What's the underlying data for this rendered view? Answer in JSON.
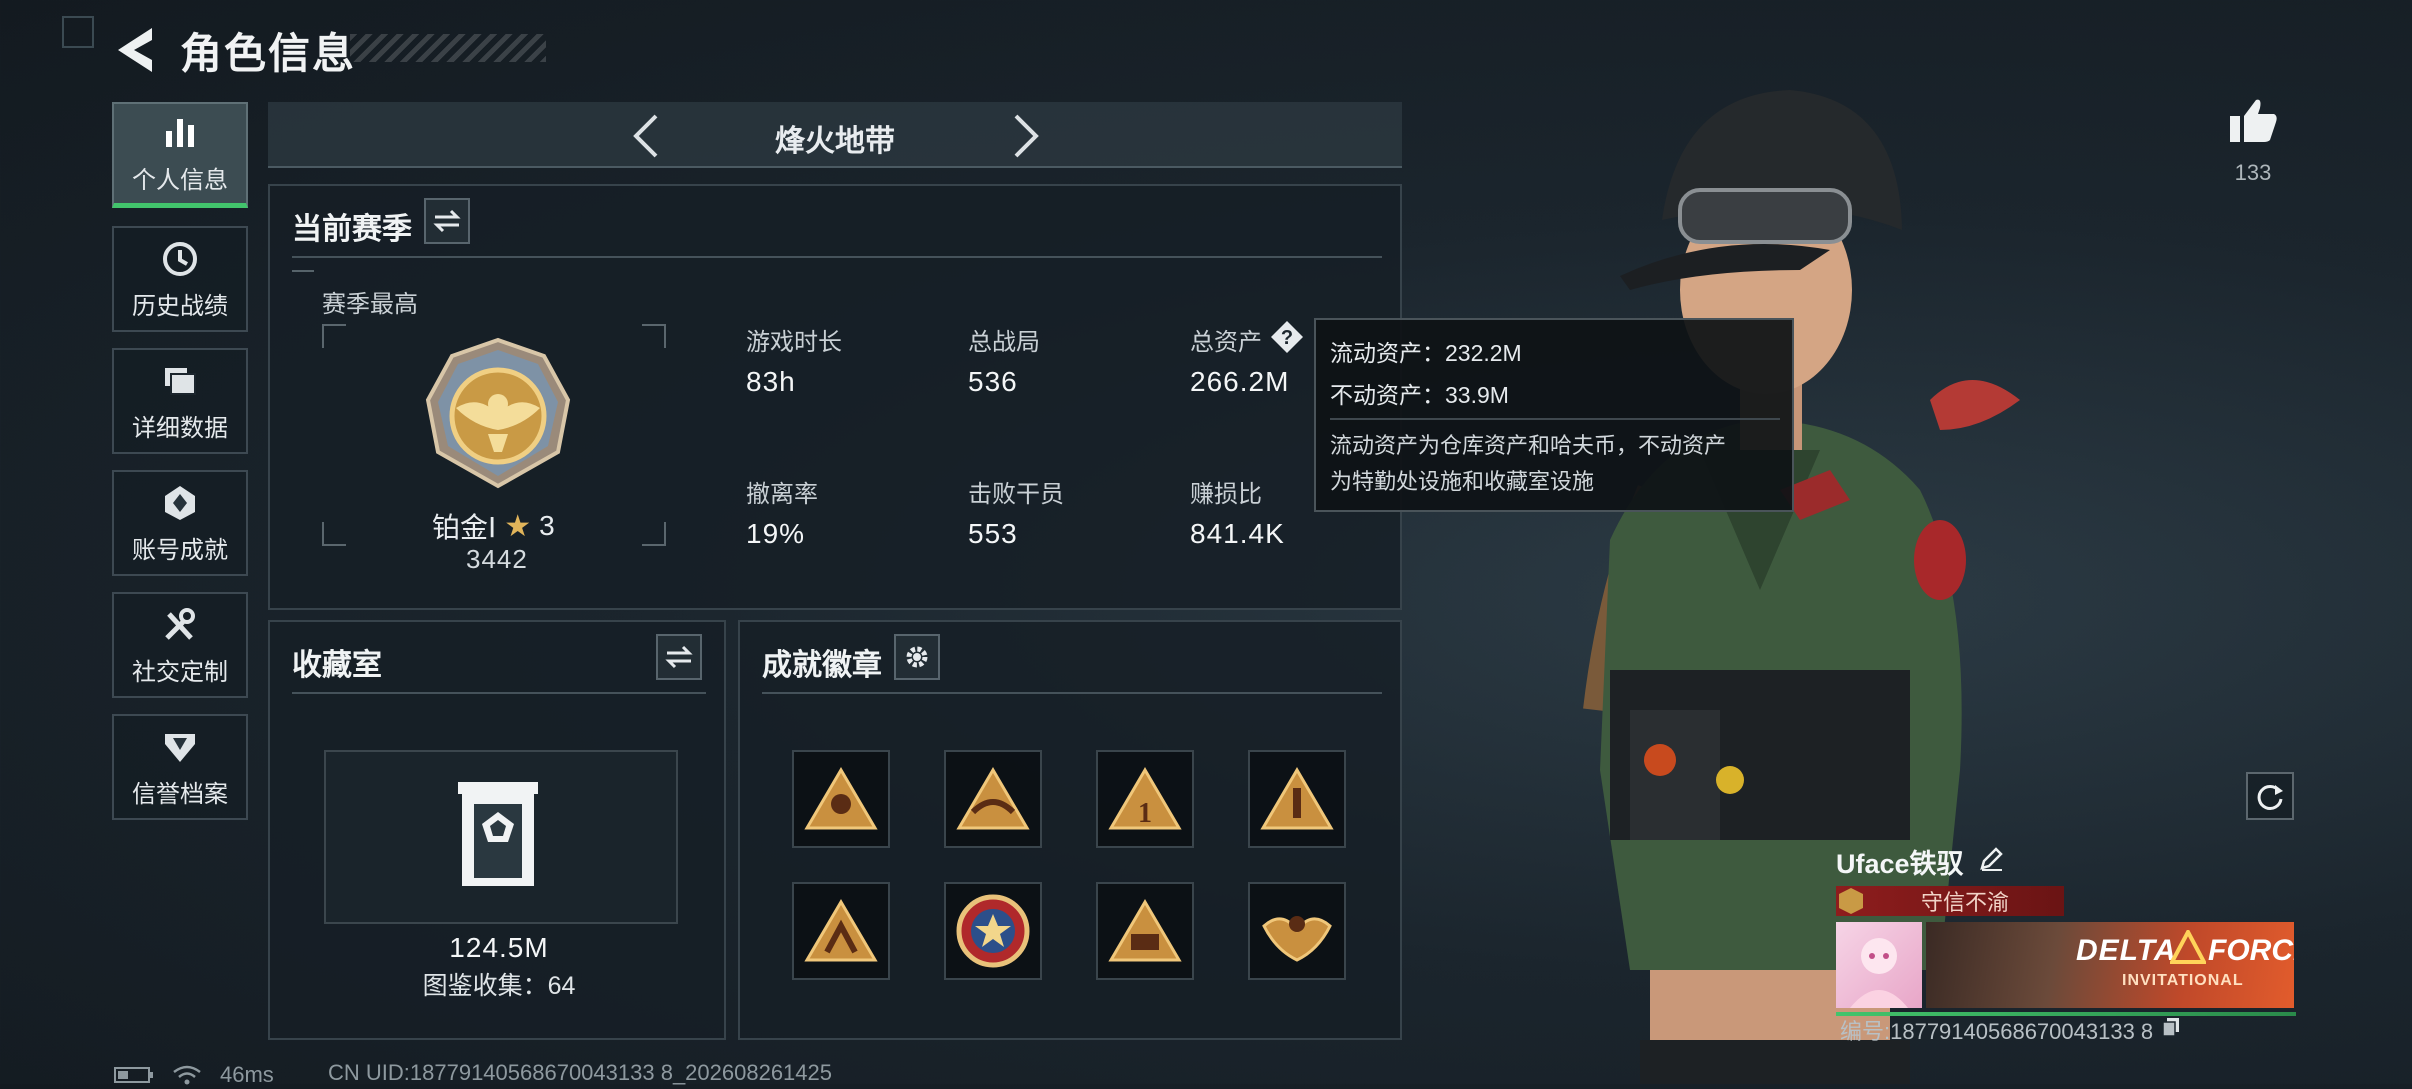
{
  "header": {
    "title": "角色信息"
  },
  "sidebar": {
    "items": [
      {
        "label": "个人信息",
        "icon": "bar-chart-icon",
        "active": true
      },
      {
        "label": "历史战绩",
        "icon": "clock-icon"
      },
      {
        "label": "详细数据",
        "icon": "folders-icon"
      },
      {
        "label": "账号成就",
        "icon": "achievement-icon"
      },
      {
        "label": "社交定制",
        "icon": "tools-icon"
      },
      {
        "label": "信誉档案",
        "icon": "shield-icon"
      }
    ]
  },
  "mode": {
    "label": "烽火地带"
  },
  "season": {
    "title": "当前赛季",
    "best_label": "赛季最高",
    "rank_name": "铂金Ⅰ",
    "rank_stars": "3",
    "rank_score": "3442",
    "stats": [
      {
        "label": "游戏时长",
        "value": "83h"
      },
      {
        "label": "总战局",
        "value": "536"
      },
      {
        "label": "总资产",
        "value": "266.2M"
      },
      {
        "label": "撤离率",
        "value": "19%"
      },
      {
        "label": "击败干员",
        "value": "553"
      },
      {
        "label": "赚损比",
        "value": "841.4K"
      }
    ]
  },
  "tooltip": {
    "line1": "流动资产：232.2M",
    "line2": "不动资产：33.9M",
    "desc1": "流动资产为仓库资产和哈夫币，不动资产",
    "desc2": "为特勤处设施和收藏室设施"
  },
  "collection": {
    "title": "收藏室",
    "value": "124.5M",
    "count_label": "图鉴收集：64"
  },
  "achievements": {
    "title": "成就徽章",
    "badges": [
      "badge-1",
      "badge-2",
      "badge-3",
      "badge-4",
      "badge-5",
      "badge-6",
      "badge-7",
      "badge-8"
    ]
  },
  "likes": {
    "count": "133"
  },
  "player": {
    "name": "Uface铁驭",
    "title_badge": "守信不渝",
    "banner_text1": "DELTA",
    "banner_text2": "FORCE",
    "banner_text3": "INVITATIONAL",
    "id_label": "编号:18779140568670043133 8"
  },
  "footer": {
    "ping": "46ms",
    "uid": "CN UID:18779140568670043133 8_202608261425"
  },
  "colors": {
    "accent_green": "#42c46c",
    "title_red": "#8e1d1d",
    "gold": "#c99a45"
  }
}
